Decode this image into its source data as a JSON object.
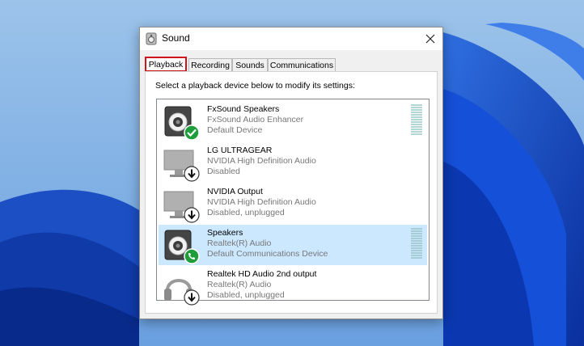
{
  "window": {
    "title": "Sound"
  },
  "tabs": [
    {
      "label": "Playback",
      "active": true
    },
    {
      "label": "Recording",
      "active": false
    },
    {
      "label": "Sounds",
      "active": false
    },
    {
      "label": "Communications",
      "active": false
    }
  ],
  "instructions": "Select a playback device below to modify its settings:",
  "devices": [
    {
      "name": "FxSound Speakers",
      "driver": "FxSound Audio Enhancer",
      "status": "Default Device",
      "icon": "speaker-icon",
      "badge": "check-badge-icon",
      "selected": false,
      "meter": true
    },
    {
      "name": "LG ULTRAGEAR",
      "driver": "NVIDIA High Definition Audio",
      "status": "Disabled",
      "icon": "monitor-icon",
      "badge": "down-arrow-badge-icon",
      "selected": false,
      "meter": false
    },
    {
      "name": "NVIDIA Output",
      "driver": "NVIDIA High Definition Audio",
      "status": "Disabled, unplugged",
      "icon": "monitor-icon",
      "badge": "down-arrow-badge-icon",
      "selected": false,
      "meter": false
    },
    {
      "name": "Speakers",
      "driver": "Realtek(R) Audio",
      "status": "Default Communications Device",
      "icon": "speaker-icon",
      "badge": "phone-badge-icon",
      "selected": true,
      "meter": true
    },
    {
      "name": "Realtek HD Audio 2nd output",
      "driver": "Realtek(R) Audio",
      "status": "Disabled, unplugged",
      "icon": "headphones-icon",
      "badge": "down-arrow-badge-icon",
      "selected": false,
      "meter": false
    }
  ],
  "colors": {
    "selection": "#cce8ff",
    "active_tab_outline": "#d0141b",
    "badge_green": "#1e9e3a"
  }
}
